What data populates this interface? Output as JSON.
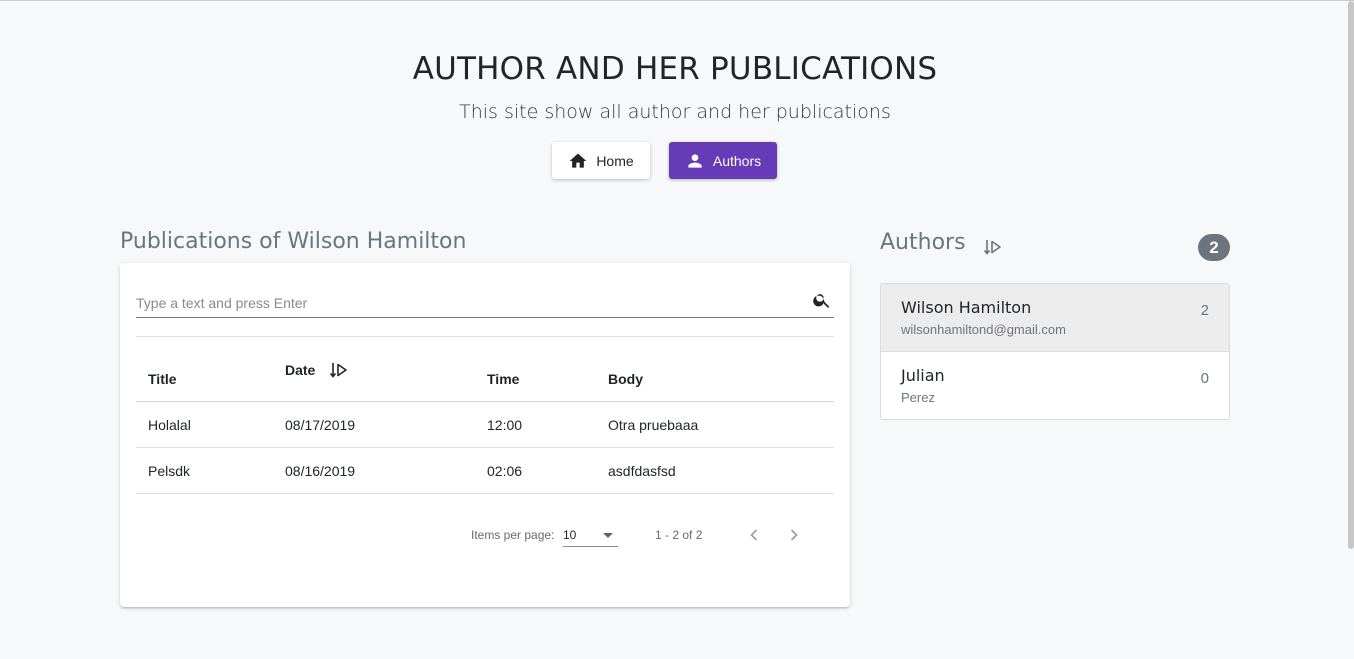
{
  "header": {
    "title": "AUTHOR AND HER PUBLICATIONS",
    "subtitle": "This site show all author and her publications"
  },
  "nav": {
    "home_label": "Home",
    "authors_label": "Authors",
    "home_icon": "home-icon",
    "authors_icon": "person-icon",
    "active_color": "#673ab7"
  },
  "publications": {
    "title": "Publications of Wilson Hamilton",
    "search_placeholder": "Type a text and press Enter",
    "columns": [
      "Title",
      "Date",
      "Time",
      "Body"
    ],
    "rows": [
      {
        "title": "Holalal",
        "date": "08/17/2019",
        "time": "12:00",
        "body": "Otra pruebaaa"
      },
      {
        "title": "Pelsdk",
        "date": "08/16/2019",
        "time": "02:06",
        "body": "asdfdasfsd"
      }
    ],
    "paginator": {
      "items_per_page_label": "Items per page:",
      "items_per_page": "10",
      "range": "1 - 2 of 2"
    }
  },
  "authors": {
    "title": "Authors",
    "count": "2",
    "items": [
      {
        "name": "Wilson Hamilton",
        "sub": "wilsonhamiltond@gmail.com",
        "count": "2",
        "active": true
      },
      {
        "name": "Julian",
        "sub": "Perez",
        "count": "0",
        "active": false
      }
    ]
  }
}
